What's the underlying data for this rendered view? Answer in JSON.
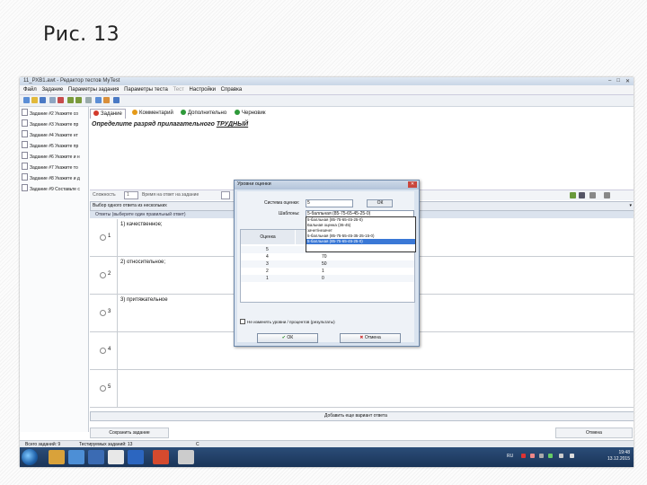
{
  "slide": {
    "title": "Рис. 13"
  },
  "window": {
    "title": "11_РХВ1.awt - Редактор тестов MyTest",
    "min": "–",
    "max": "□",
    "close": "✕"
  },
  "menu": {
    "items": [
      "Файл",
      "Задание",
      "Параметры задания",
      "Параметры теста",
      "Тест",
      "Настройки",
      "Справка"
    ]
  },
  "left_panel": {
    "items": [
      "Задание #2 Укажите со",
      "Задание #3 Укажите пр",
      "Задание #4 Укажите нт",
      "Задание #5 Укажите пр",
      "Задание #6 Укажите и н",
      "Задание #7 Укажите то",
      "Задание #8 Укажите и д",
      "Задание #9 Составьте с"
    ]
  },
  "tabs": [
    {
      "label": "Задание",
      "color": "#d33a2c"
    },
    {
      "label": "Комментарий",
      "color": "#e59a18"
    },
    {
      "label": "Дополнительно",
      "color": "#2e9a3a"
    },
    {
      "label": "Черновик",
      "color": "#2e9a3a"
    }
  ],
  "question": {
    "text": "Определите разряд прилагательного",
    "underlined": "ТРУДНЫЙ"
  },
  "params": {
    "label1": "Сложность",
    "value1": "1",
    "label2": "Время на ответ на задание",
    "label3": "..."
  },
  "answer_type": {
    "label": "Выбор одного ответа из нескольких"
  },
  "answers_header": "Ответы (выберите один правильный ответ)",
  "answers": [
    {
      "num": "1",
      "text": "1) качественное;"
    },
    {
      "num": "2",
      "text": "2) относительное;"
    },
    {
      "num": "3",
      "text": "3) притяжательное"
    },
    {
      "num": "4",
      "text": ""
    },
    {
      "num": "5",
      "text": ""
    }
  ],
  "add_answer": "Добавить еще вариант ответа",
  "bottom_buttons": {
    "save": "Сохранить задание",
    "right": "Отмена"
  },
  "status": {
    "left": "Всего заданий: 9",
    "middle": "Тестируемых заданий: 13",
    "right": "С"
  },
  "taskbar": {
    "lang": "RU",
    "time": "19:48",
    "date": "13.12.2015"
  },
  "dialog": {
    "title": "Уровни оценки",
    "system_label": "Система оценки:",
    "system_value": "5",
    "ok_small": "ОК",
    "template_label": "Шаблоны:",
    "template_value": "5-балльная (85-75-65-45-25-0)",
    "dropdown": [
      "5-балльная (85-75-65-45-25-0)",
      "Бальная оценка (36-45)",
      "зачет/незачет",
      "5-балльная (85-75-55-45-35-25-15-0)",
      "5-балльная (85-75-65-45-25-0)"
    ],
    "grid_headers": [
      "Оценка",
      "%"
    ],
    "grid_rows": [
      {
        "grade": "5",
        "pct": "85"
      },
      {
        "grade": "4",
        "pct": "70"
      },
      {
        "grade": "3",
        "pct": "50"
      },
      {
        "grade": "2",
        "pct": "1"
      },
      {
        "grade": "1",
        "pct": "0"
      }
    ],
    "checkbox": "Не изменять уровни / процентов (результаты)",
    "ok": "ОК",
    "cancel": "Отмена"
  }
}
